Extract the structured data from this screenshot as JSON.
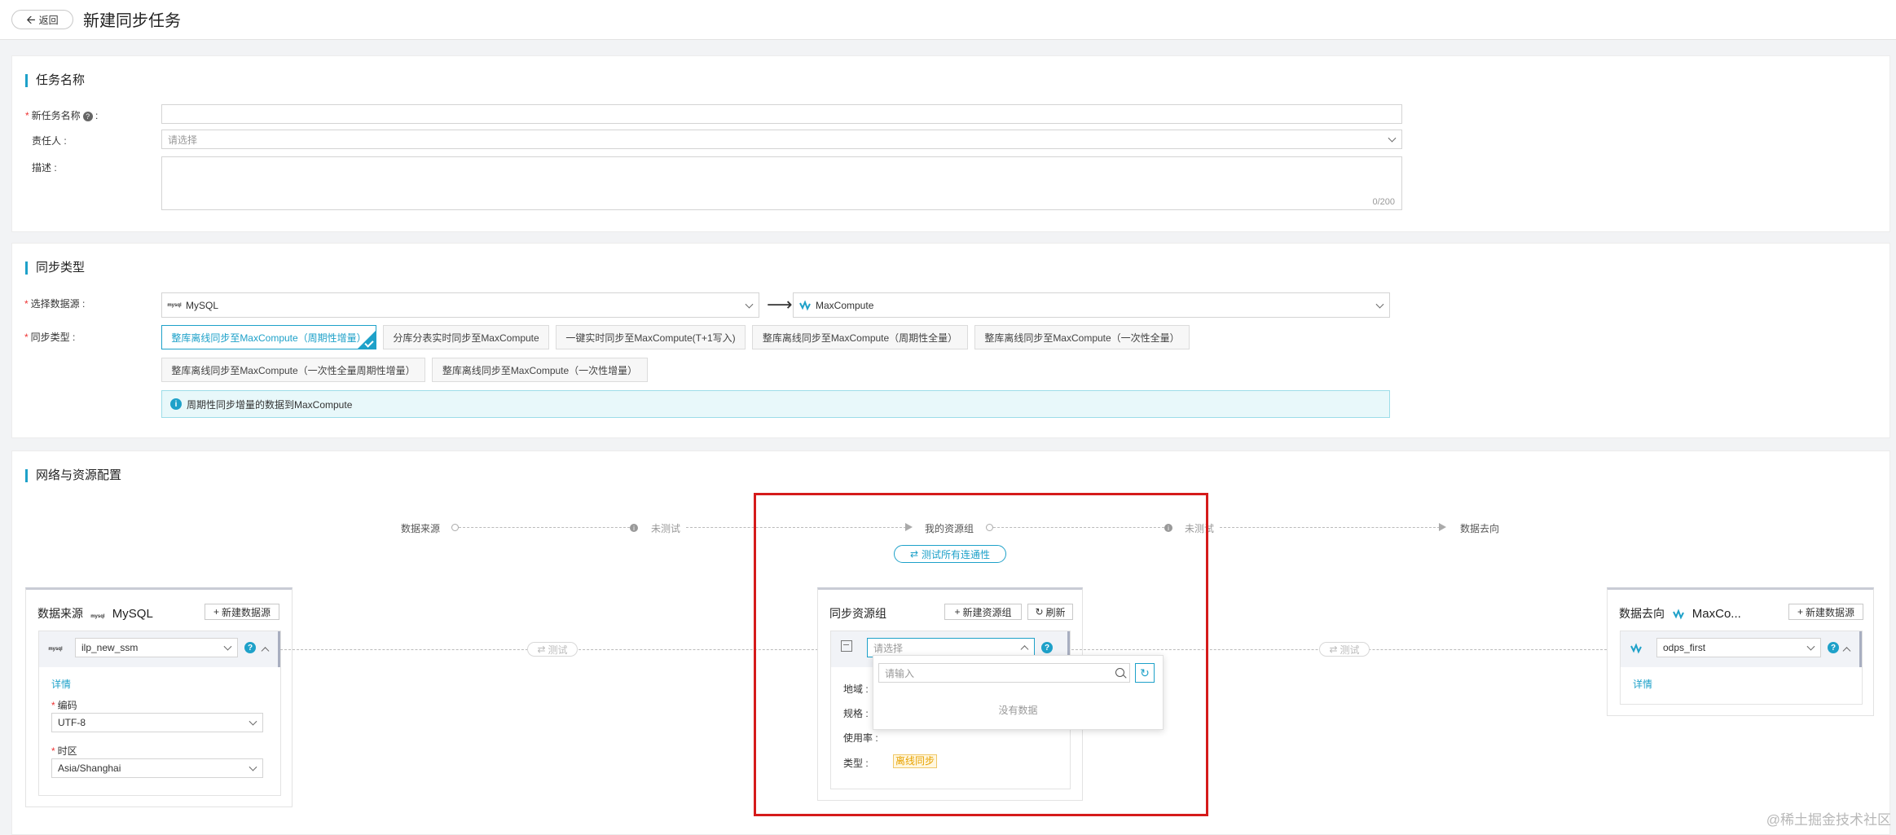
{
  "header": {
    "back_label": "返回",
    "title": "新建同步任务"
  },
  "task_section": {
    "title": "任务名称",
    "name_label": "新任务名称",
    "name_suffix": ":",
    "owner_label": "责任人 :",
    "owner_placeholder": "请选择",
    "desc_label": "描述 :",
    "desc_counter": "0/200"
  },
  "sync_section": {
    "title": "同步类型",
    "source_label": "选择数据源 :",
    "source_value": "MySQL",
    "target_value": "MaxCompute",
    "type_label": "同步类型 :",
    "types": [
      "整库离线同步至MaxCompute（周期性增量）",
      "分库分表实时同步至MaxCompute",
      "一键实时同步至MaxCompute(T+1写入)",
      "整库离线同步至MaxCompute（周期性全量）",
      "整库离线同步至MaxCompute（一次性全量）",
      "整库离线同步至MaxCompute（一次性全量周期性增量）",
      "整库离线同步至MaxCompute（一次性增量）"
    ],
    "info_text": "周期性同步增量的数据到MaxCompute"
  },
  "network_section": {
    "title": "网络与资源配置",
    "flow": {
      "source": "数据来源",
      "untested_1": "未测试",
      "resource_group": "我的资源组",
      "untested_2": "未测试",
      "target": "数据去向"
    },
    "test_all_label": "测试所有连通性",
    "test_label": "测试",
    "source_panel": {
      "title": "数据来源",
      "db_name": "MySQL",
      "new_btn": "新建数据源",
      "selected": "ilp_new_ssm",
      "detail_link": "详情",
      "encoding_label": "编码",
      "encoding_value": "UTF-8",
      "timezone_label": "时区",
      "timezone_value": "Asia/Shanghai"
    },
    "resource_panel": {
      "title": "同步资源组",
      "new_btn": "新建资源组",
      "refresh_btn": "刷新",
      "select_placeholder": "请选择",
      "search_placeholder": "请输入",
      "no_data": "没有数据",
      "region_label": "地域 :",
      "spec_label": "规格 :",
      "usage_label": "使用率 :",
      "type_label": "类型 :",
      "type_value": "离线同步"
    },
    "target_panel": {
      "title": "数据去向",
      "db_name": "MaxCo...",
      "new_btn": "新建数据源",
      "selected": "odps_first",
      "detail_link": "详情"
    }
  },
  "watermark": "@稀土掘金技术社区",
  "colors": {
    "accent": "#1ea1c9",
    "highlight_frame": "#d51b1b",
    "offline_tag": "#e8a200"
  }
}
